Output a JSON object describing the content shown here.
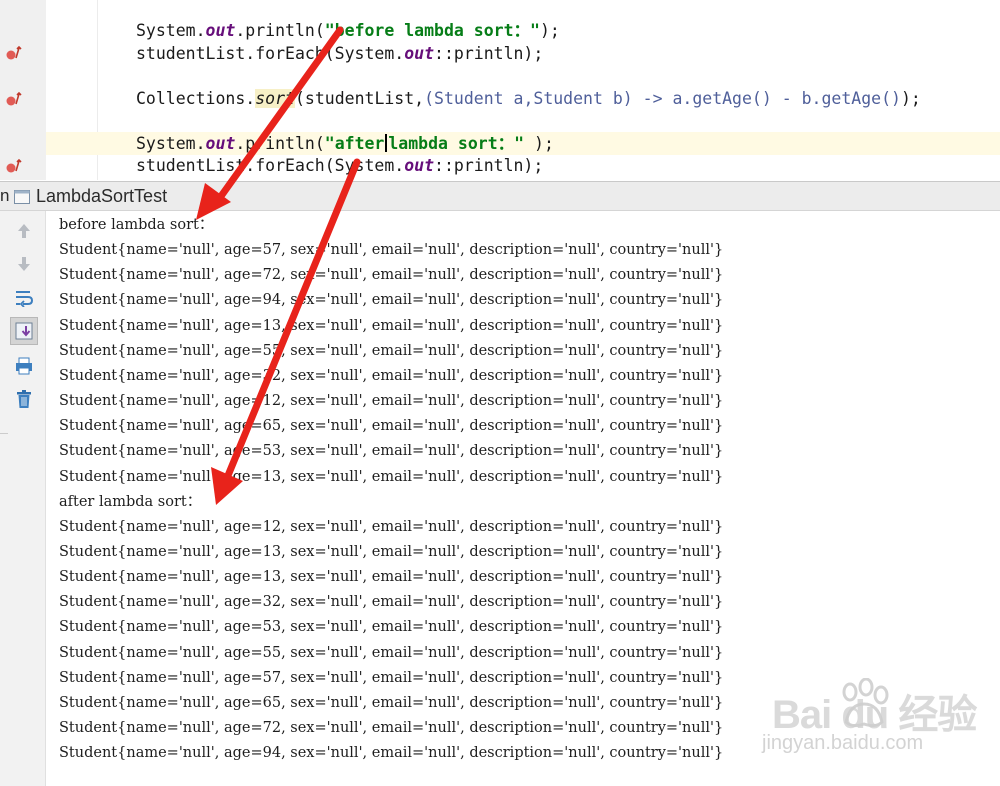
{
  "editor": {
    "lines": [
      {
        "parts": [
          {
            "t": "System."
          },
          {
            "t": "out",
            "c": "k-field"
          },
          {
            "t": ".println("
          },
          {
            "t": "\"before lambda sort：\"",
            "c": "k-str"
          },
          {
            "t": ");"
          }
        ]
      },
      {
        "parts": [
          {
            "t": "studentList.forEach(System."
          },
          {
            "t": "out",
            "c": "k-field"
          },
          {
            "t": "::println);"
          }
        ]
      },
      {
        "parts": [
          {
            "t": "Collections."
          },
          {
            "t": "sort",
            "c": "k-method"
          },
          {
            "t": "(studentList,"
          },
          {
            "t": "(Student a,Student b) -> a.getAge() - b.getAge()",
            "c": "k-lambda"
          },
          {
            "t": ");"
          }
        ]
      },
      {
        "parts": [
          {
            "t": "System."
          },
          {
            "t": "out",
            "c": "k-field"
          },
          {
            "t": ".println("
          },
          {
            "t": "\"after",
            "c": "k-str"
          },
          {
            "caret": true
          },
          {
            "t": "lambda sort：\"",
            "c": "k-str"
          },
          {
            "t": " );"
          }
        ]
      },
      {
        "parts": [
          {
            "t": "studentList.forEach(System."
          },
          {
            "t": "out",
            "c": "k-field"
          },
          {
            "t": "::println);"
          }
        ]
      }
    ]
  },
  "run_window": {
    "prefix": "n",
    "tab_title": "LambdaSortTest",
    "toolbar_icons": [
      "up-arrow-icon",
      "down-arrow-icon",
      "soft-wrap-icon",
      "scroll-to-end-icon",
      "print-icon",
      "trash-icon"
    ]
  },
  "console": {
    "lines": [
      "before lambda sort：",
      "Student{name='null', age=57, sex='null', email='null', description='null', country='null'}",
      "Student{name='null', age=72, sex='null', email='null', description='null', country='null'}",
      "Student{name='null', age=94, sex='null', email='null', description='null', country='null'}",
      "Student{name='null', age=13, sex='null', email='null', description='null', country='null'}",
      "Student{name='null', age=55, sex='null', email='null', description='null', country='null'}",
      "Student{name='null', age=32, sex='null', email='null', description='null', country='null'}",
      "Student{name='null', age=12, sex='null', email='null', description='null', country='null'}",
      "Student{name='null', age=65, sex='null', email='null', description='null', country='null'}",
      "Student{name='null', age=53, sex='null', email='null', description='null', country='null'}",
      "Student{name='null', age=13, sex='null', email='null', description='null', country='null'}",
      "after lambda sort：",
      "Student{name='null', age=12, sex='null', email='null', description='null', country='null'}",
      "Student{name='null', age=13, sex='null', email='null', description='null', country='null'}",
      "Student{name='null', age=13, sex='null', email='null', description='null', country='null'}",
      "Student{name='null', age=32, sex='null', email='null', description='null', country='null'}",
      "Student{name='null', age=53, sex='null', email='null', description='null', country='null'}",
      "Student{name='null', age=55, sex='null', email='null', description='null', country='null'}",
      "Student{name='null', age=57, sex='null', email='null', description='null', country='null'}",
      "Student{name='null', age=65, sex='null', email='null', description='null', country='null'}",
      "Student{name='null', age=72, sex='null', email='null', description='null', country='null'}",
      "Student{name='null', age=94, sex='null', email='null', description='null', country='null'}"
    ]
  },
  "watermark": {
    "brand": "Bai du 经验",
    "sub": "jingyan.baidu.com"
  },
  "colors": {
    "annotation_arrow": "#e8231b",
    "string_literal": "#067d17",
    "static_field": "#660e7a",
    "gutter_marker": "#d9534f"
  }
}
